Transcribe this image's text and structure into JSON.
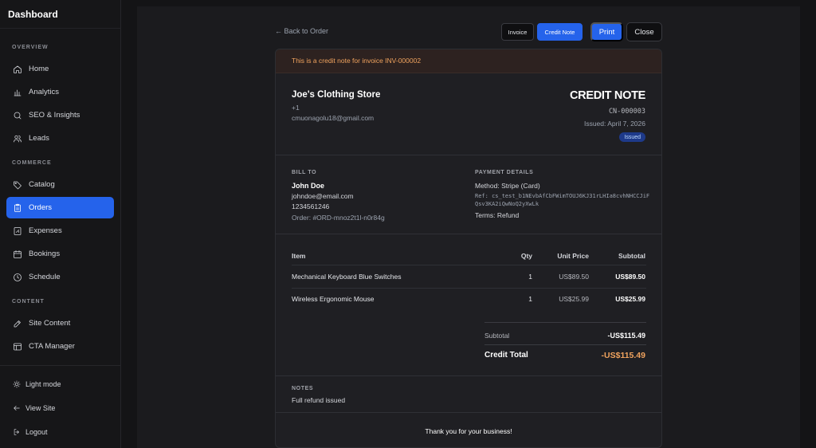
{
  "sidebar": {
    "title": "Dashboard",
    "sections": {
      "overview": "OVERVIEW",
      "commerce": "COMMERCE",
      "content": "CONTENT"
    },
    "items": {
      "home": "Home",
      "analytics": "Analytics",
      "seo": "SEO & Insights",
      "leads": "Leads",
      "catalog": "Catalog",
      "orders": "Orders",
      "expenses": "Expenses",
      "bookings": "Bookings",
      "schedule": "Schedule",
      "site_content": "Site Content",
      "cta_manager": "CTA Manager"
    },
    "active_item": "Orders",
    "bottom": {
      "light_mode": "Light mode",
      "view_site": "View Site",
      "logout": "Logout"
    }
  },
  "toolbar": {
    "back": "← Back to Order",
    "invoice": "Invoice",
    "credit_note": "Credit Note",
    "print": "Print",
    "close": "Close"
  },
  "banner": "This is a credit note for invoice INV-000002",
  "store": {
    "name": "Joe's Clothing Store",
    "phone": "+1",
    "email": "cmuonagolu18@gmail.com"
  },
  "document": {
    "title": "CREDIT NOTE",
    "number": "CN-000003",
    "issued": "Issued: April 7, 2026",
    "status": "Issued"
  },
  "bill_to": {
    "label": "BILL TO",
    "name": "John Doe",
    "email": "johndoe@email.com",
    "phone": "1234561246",
    "order": "Order: #ORD-mnoz2t1l-n0r84g"
  },
  "payment": {
    "label": "PAYMENT DETAILS",
    "method": "Method: Stripe (Card)",
    "ref": "Ref: cs_test_b1NEvbAfCbFWimTOUJ6KJ31rLHIa8cvhNHCCJiFQsv3KA2iQwNoQ2yXwLk",
    "terms": "Terms: Refund"
  },
  "table": {
    "headers": {
      "item": "Item",
      "qty": "Qty",
      "unit_price": "Unit Price",
      "subtotal": "Subtotal"
    },
    "rows": [
      {
        "item": "Mechanical Keyboard Blue Switches",
        "qty": "1",
        "unit_price": "US$89.50",
        "subtotal": "US$89.50"
      },
      {
        "item": "Wireless Ergonomic Mouse",
        "qty": "1",
        "unit_price": "US$25.99",
        "subtotal": "US$25.99"
      }
    ]
  },
  "totals": {
    "subtotal_label": "Subtotal",
    "subtotal_value": "-US$115.49",
    "credit_label": "Credit Total",
    "credit_value": "-US$115.49"
  },
  "notes": {
    "label": "NOTES",
    "text": "Full refund issued"
  },
  "footer": "Thank you for your business!",
  "colors": {
    "accent": "#2563eb",
    "warning": "#f0a35e",
    "background": "#141416"
  },
  "icons": {
    "home": "home-icon",
    "analytics": "bar-chart-icon",
    "seo": "search-icon",
    "leads": "users-icon",
    "catalog": "tag-icon",
    "orders": "clipboard-icon",
    "expenses": "receipt-icon",
    "bookings": "calendar-icon",
    "schedule": "clock-icon",
    "site_content": "edit-icon",
    "cta_manager": "layout-icon",
    "light_mode": "sun-icon",
    "view_site": "arrow-left-icon",
    "logout": "logout-icon"
  }
}
